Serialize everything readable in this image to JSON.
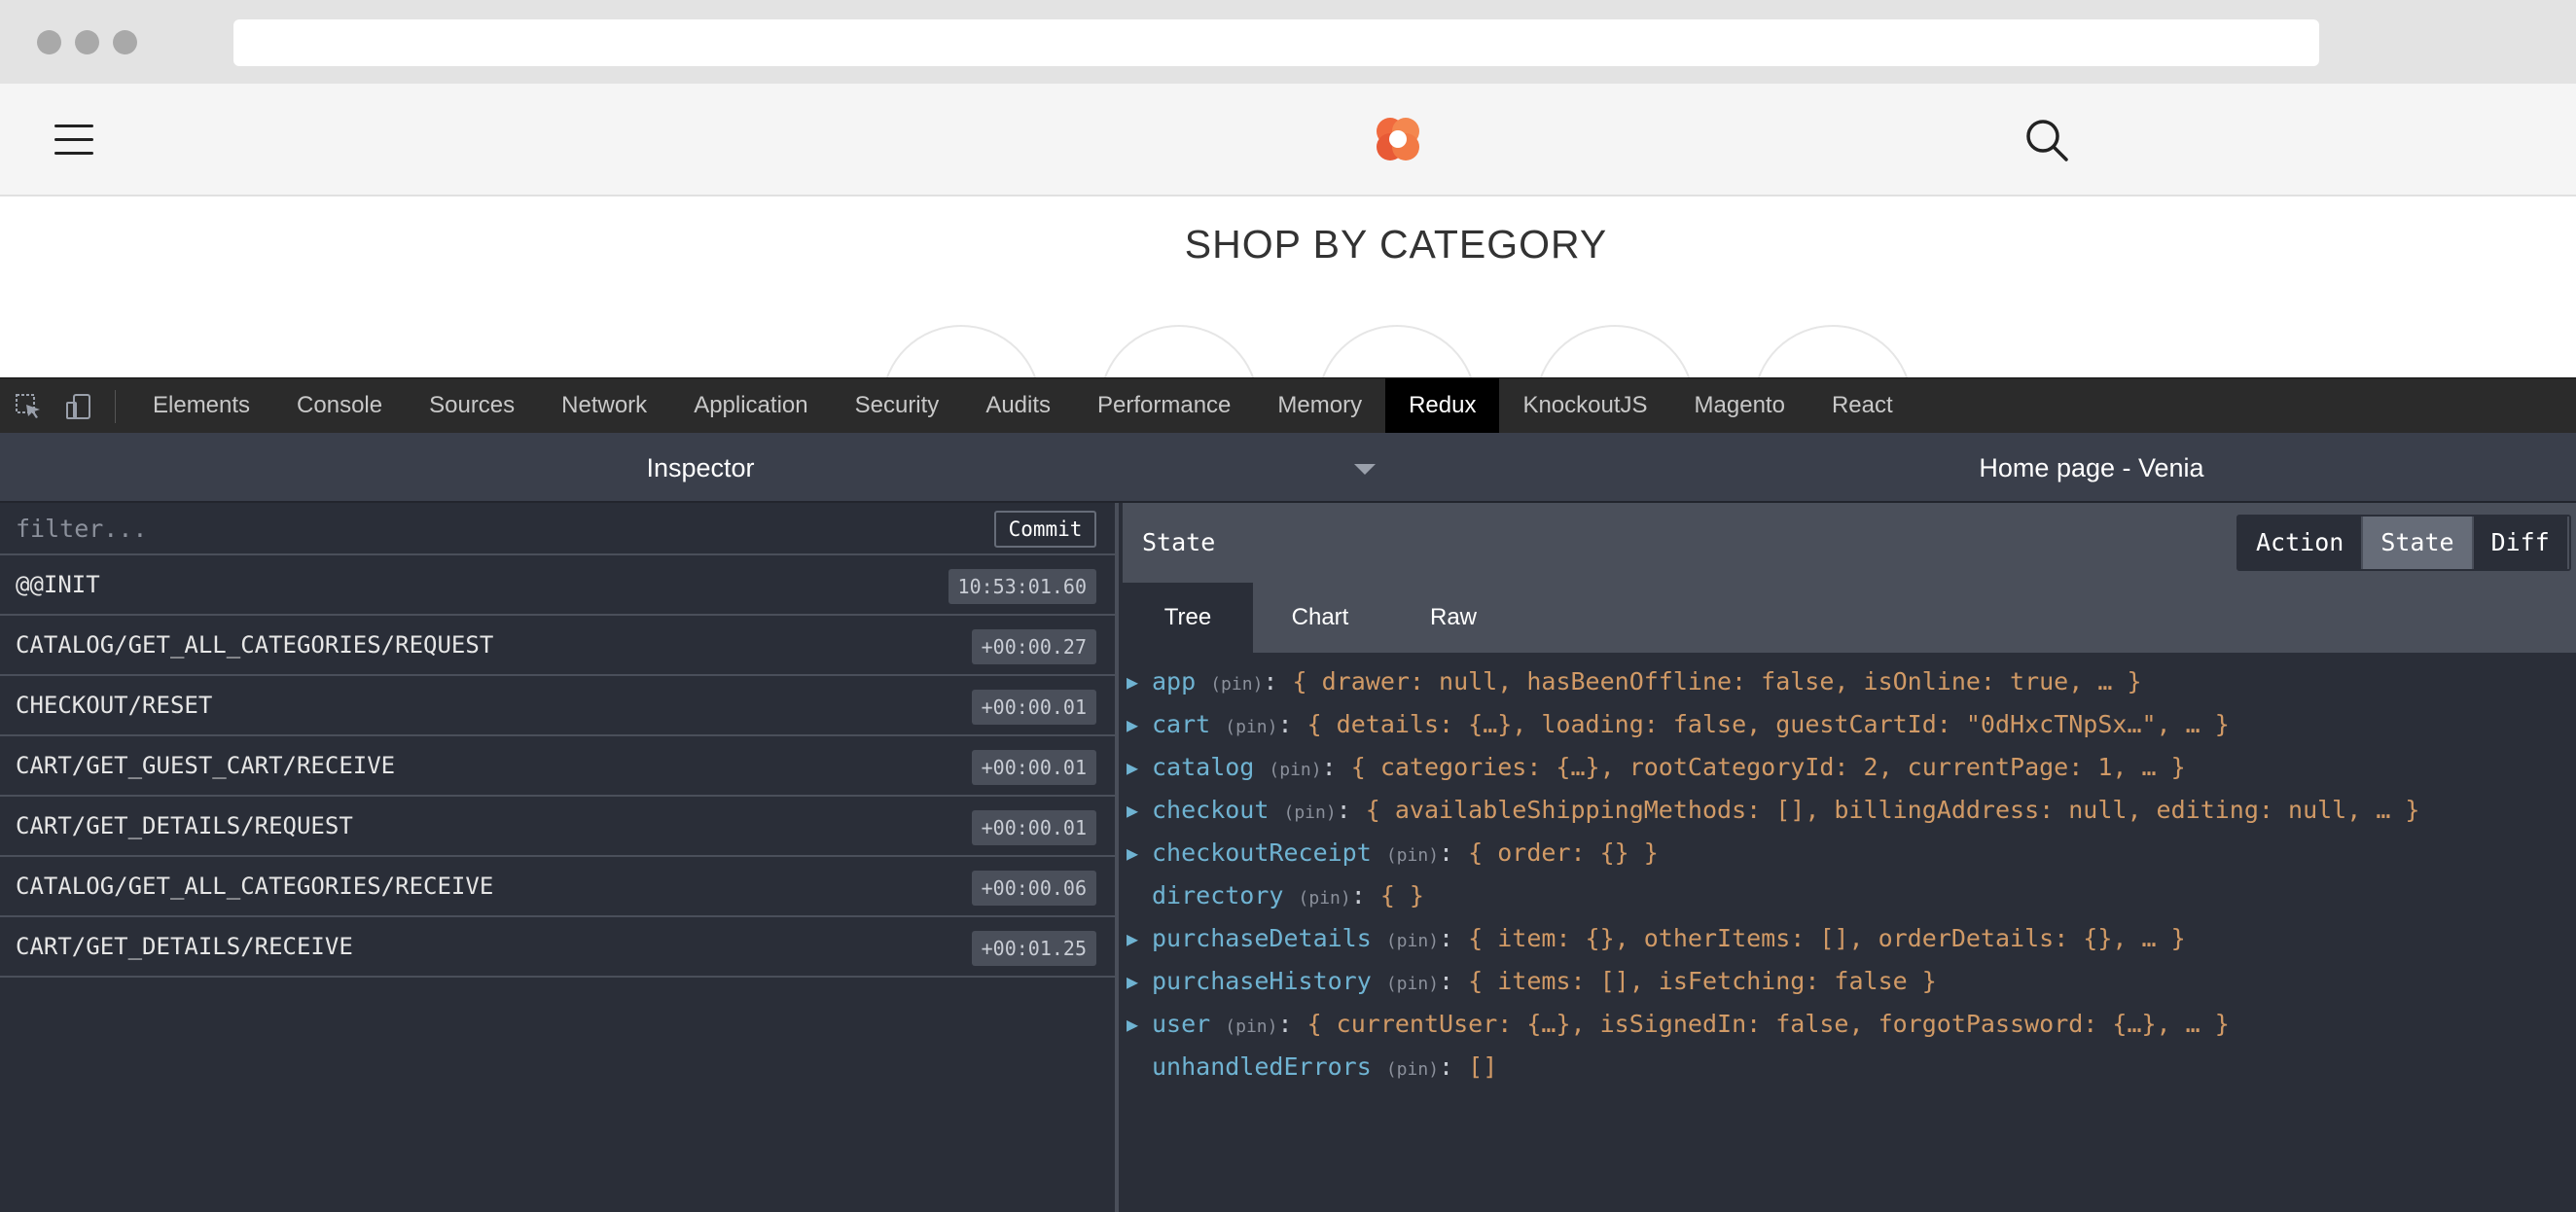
{
  "site": {
    "title": "SHOP BY CATEGORY"
  },
  "devtools": {
    "tabs": [
      {
        "label": "Elements"
      },
      {
        "label": "Console"
      },
      {
        "label": "Sources"
      },
      {
        "label": "Network"
      },
      {
        "label": "Application"
      },
      {
        "label": "Security"
      },
      {
        "label": "Audits"
      },
      {
        "label": "Performance"
      },
      {
        "label": "Memory"
      },
      {
        "label": "Redux",
        "active": true
      },
      {
        "label": "KnockoutJS"
      },
      {
        "label": "Magento"
      },
      {
        "label": "React"
      }
    ]
  },
  "redux": {
    "monitor": "Inspector",
    "instance": "Home page - Venia",
    "filter_placeholder": "filter...",
    "commit_label": "Commit",
    "actions": [
      {
        "name": "@@INIT",
        "time": "10:53:01.60"
      },
      {
        "name": "CATALOG/GET_ALL_CATEGORIES/REQUEST",
        "time": "+00:00.27"
      },
      {
        "name": "CHECKOUT/RESET",
        "time": "+00:00.01"
      },
      {
        "name": "CART/GET_GUEST_CART/RECEIVE",
        "time": "+00:00.01"
      },
      {
        "name": "CART/GET_DETAILS/REQUEST",
        "time": "+00:00.01"
      },
      {
        "name": "CATALOG/GET_ALL_CATEGORIES/RECEIVE",
        "time": "+00:00.06"
      },
      {
        "name": "CART/GET_DETAILS/RECEIVE",
        "time": "+00:01.25"
      }
    ],
    "state_title": "State",
    "modes": [
      {
        "label": "Action"
      },
      {
        "label": "State",
        "active": true
      },
      {
        "label": "Diff"
      }
    ],
    "subtabs": [
      {
        "label": "Tree",
        "active": true
      },
      {
        "label": "Chart"
      },
      {
        "label": "Raw"
      }
    ],
    "tree": [
      {
        "key": "app",
        "expandable": true,
        "preview": "{ drawer: null, hasBeenOffline: false, isOnline: true, … }"
      },
      {
        "key": "cart",
        "expandable": true,
        "preview": "{ details: {…}, loading: false, guestCartId: \"0dHxcTNpSx…\", … }"
      },
      {
        "key": "catalog",
        "expandable": true,
        "preview": "{ categories: {…}, rootCategoryId: 2, currentPage: 1, … }"
      },
      {
        "key": "checkout",
        "expandable": true,
        "preview": "{ availableShippingMethods: [], billingAddress: null, editing: null, … }"
      },
      {
        "key": "checkoutReceipt",
        "expandable": true,
        "preview": "{ order: {} }"
      },
      {
        "key": "directory",
        "expandable": false,
        "preview": "{ }"
      },
      {
        "key": "purchaseDetails",
        "expandable": true,
        "preview": "{ item: {}, otherItems: [], orderDetails: {}, … }"
      },
      {
        "key": "purchaseHistory",
        "expandable": true,
        "preview": "{ items: [], isFetching: false }"
      },
      {
        "key": "user",
        "expandable": true,
        "preview": "{ currentUser: {…}, isSignedIn: false, forgotPassword: {…}, … }"
      },
      {
        "key": "unhandledErrors",
        "expandable": false,
        "preview": "[]"
      }
    ],
    "pin_label": "(pin)"
  }
}
